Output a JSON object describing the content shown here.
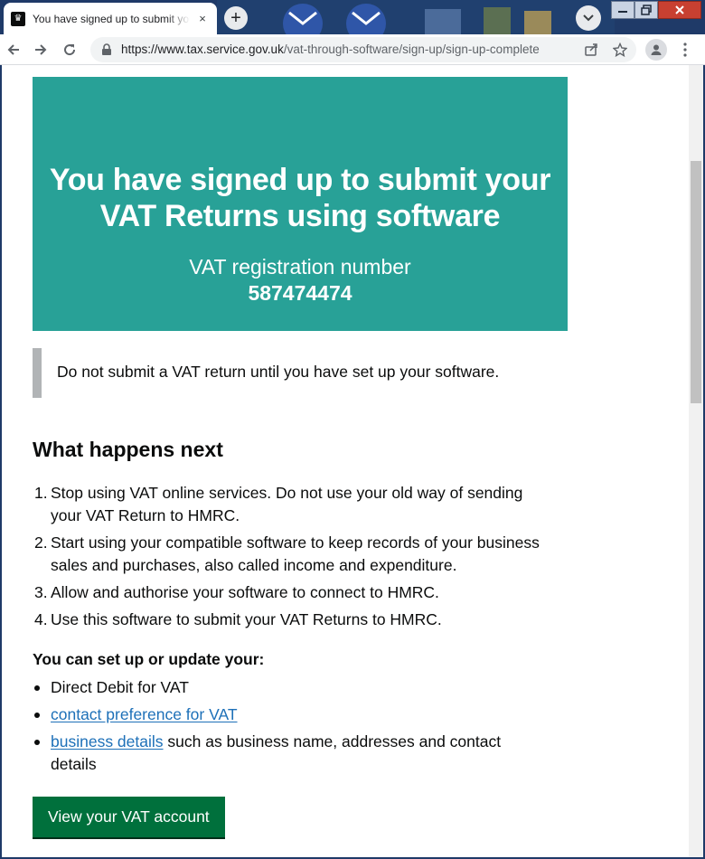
{
  "browser": {
    "tab_title": "You have signed up to submit your VAT Returns using software",
    "tab_close": "×",
    "new_tab": "+",
    "url_host": "https://www.tax.service.gov.uk",
    "url_path": "/vat-through-software/sign-up/sign-up-complete"
  },
  "panel": {
    "title_line1": "You have signed up to submit your",
    "title_line2": "VAT Returns using software",
    "label": "VAT registration number",
    "number": "587474474"
  },
  "inset": {
    "text": "Do not submit a VAT return until you have set up your software."
  },
  "next": {
    "heading": "What happens next",
    "steps": [
      {
        "n": "1.",
        "line1": "Stop using VAT online services. Do not use your old way of sending",
        "line2": "your VAT Return to HMRC."
      },
      {
        "n": "2.",
        "line1": "Start using your compatible software to keep records of your business",
        "line2": "sales and purchases, also called income and expenditure."
      },
      {
        "n": "3.",
        "line1": "Allow and authorise your software to connect to HMRC.",
        "line2": ""
      },
      {
        "n": "4.",
        "line1": "Use this software to submit your VAT Returns to HMRC.",
        "line2": ""
      }
    ]
  },
  "setup": {
    "heading": "You can set up or update your:",
    "item1": "Direct Debit for VAT",
    "item2_link": "contact preference for VAT",
    "item3_link": "business details",
    "item3_rest": " such as business name, addresses and contact",
    "item3_line2": "details"
  },
  "button": {
    "label": "View your VAT account"
  },
  "colors": {
    "panel": "#28a197",
    "link": "#1d70b8",
    "button": "#00703c"
  }
}
